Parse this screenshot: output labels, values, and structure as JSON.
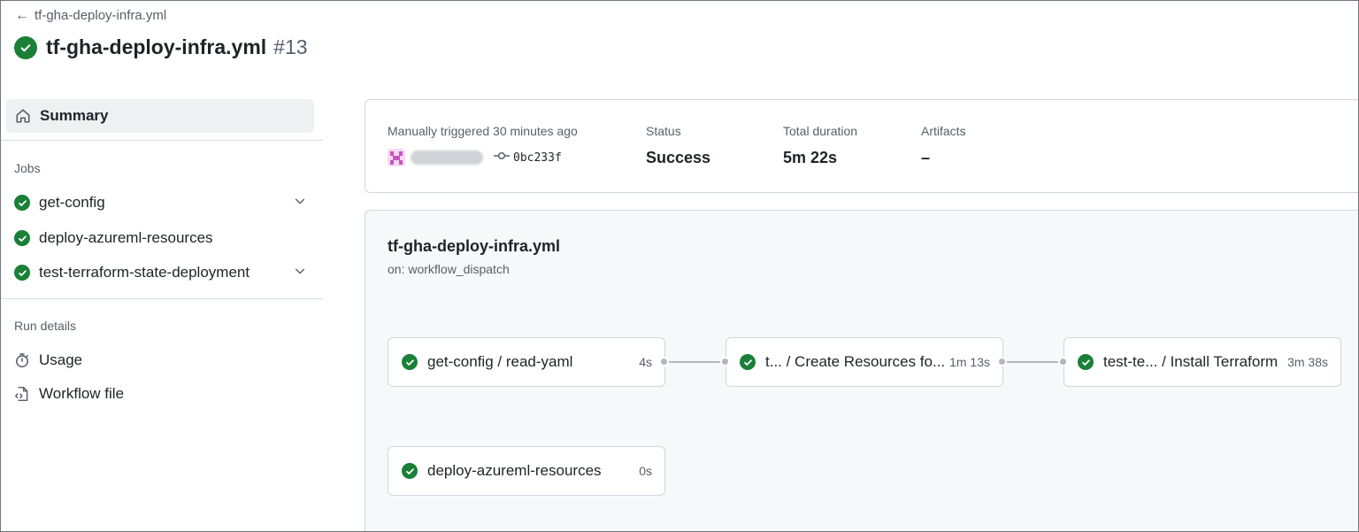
{
  "header": {
    "back_label": "tf-gha-deploy-infra.yml",
    "title": "tf-gha-deploy-infra.yml",
    "run_number": "#13"
  },
  "sidebar": {
    "summary_label": "Summary",
    "jobs_heading": "Jobs",
    "jobs": [
      {
        "label": "get-config",
        "expandable": true,
        "status": "success"
      },
      {
        "label": "deploy-azureml-resources",
        "expandable": false,
        "status": "success"
      },
      {
        "label": "test-terraform-state-deployment",
        "expandable": true,
        "status": "success"
      }
    ],
    "run_details_heading": "Run details",
    "usage_label": "Usage",
    "workflow_file_label": "Workflow file"
  },
  "summary": {
    "trigger_label": "Manually triggered 30 minutes ago",
    "commit_sha": "0bc233f",
    "status_label": "Status",
    "status_value": "Success",
    "duration_label": "Total duration",
    "duration_value": "5m 22s",
    "artifacts_label": "Artifacts",
    "artifacts_value": "–"
  },
  "graph": {
    "workflow_name": "tf-gha-deploy-infra.yml",
    "trigger": "on: workflow_dispatch",
    "nodes": [
      {
        "name": "get-config / read-yaml",
        "duration": "4s"
      },
      {
        "name": "t... / Create Resources fo...",
        "duration": "1m 13s"
      },
      {
        "name": "test-te... / Install Terraform",
        "duration": "3m 38s"
      },
      {
        "name": "deploy-azureml-resources",
        "duration": "0s"
      }
    ]
  },
  "colors": {
    "success": "#1a7f37",
    "connector": "#afb8c1",
    "panel_bg": "#f6f8fa",
    "selected_bg": "#eef0f2"
  }
}
